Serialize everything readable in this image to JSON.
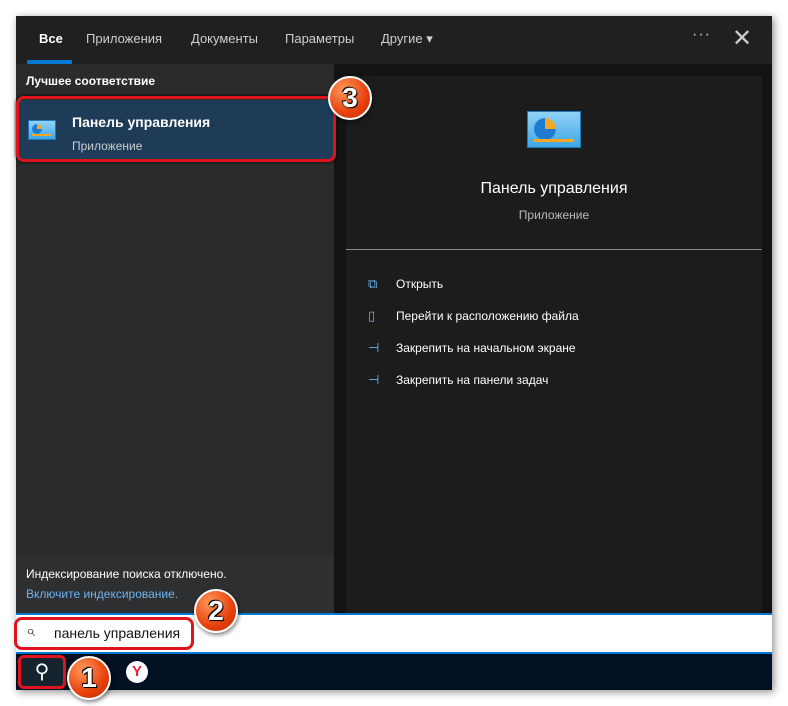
{
  "tabs": [
    {
      "label": "Все"
    },
    {
      "label": "Приложения"
    },
    {
      "label": "Документы"
    },
    {
      "label": "Параметры"
    },
    {
      "label": "Другие ▾"
    }
  ],
  "header": {
    "more": "···",
    "close": "✕"
  },
  "left": {
    "section_title": "Лучшее соответствие",
    "best": {
      "title": "Панель управления",
      "subtitle": "Приложение"
    },
    "notice": "Индексирование поиска отключено.",
    "notice_link": "Включите индексирование."
  },
  "right": {
    "title": "Панель управления",
    "subtitle": "Приложение",
    "actions": [
      {
        "icon": "open-icon",
        "glyph": "⧉",
        "label": "Открыть"
      },
      {
        "icon": "file-location-icon",
        "glyph": "▯",
        "label": "Перейти к расположению файла"
      },
      {
        "icon": "pin-icon",
        "glyph": "⊣",
        "label": "Закрепить на начальном экране"
      },
      {
        "icon": "pin-icon",
        "glyph": "⊣",
        "label": "Закрепить на панели задач"
      }
    ]
  },
  "search": {
    "value": "панель управления",
    "icon": "⌕"
  },
  "taskbar": {
    "search_icon": "⚲",
    "yandex": "Y"
  },
  "badges": [
    "1",
    "2",
    "3"
  ],
  "colors": {
    "accent": "#0078d4",
    "highlight": "#e0141c",
    "selected": "#1e3c58"
  }
}
